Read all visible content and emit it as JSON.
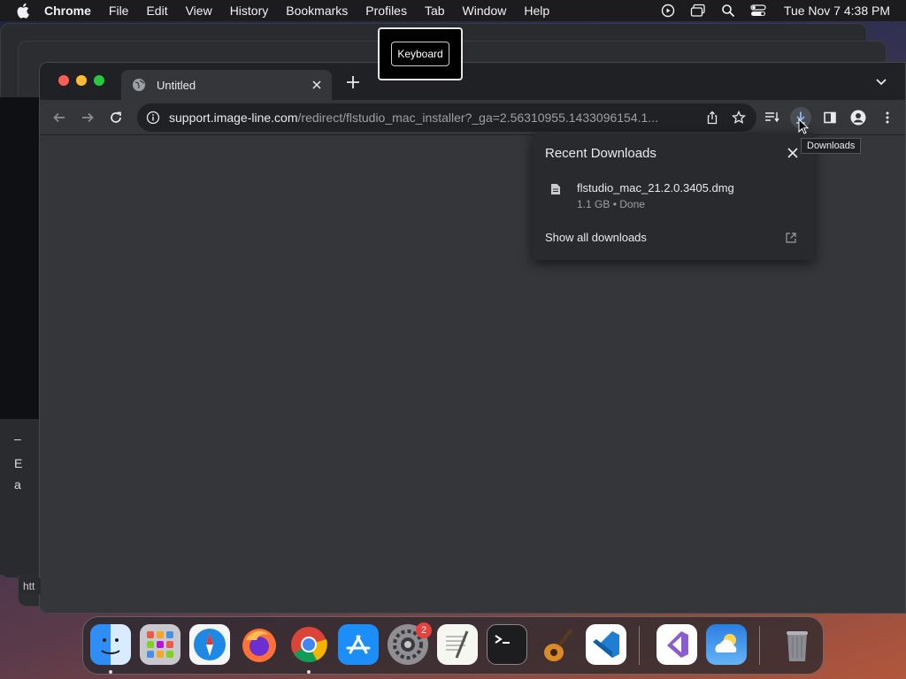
{
  "menubar": {
    "app": "Chrome",
    "items": [
      "File",
      "Edit",
      "View",
      "History",
      "Bookmarks",
      "Profiles",
      "Tab",
      "Window",
      "Help"
    ],
    "clock": "Tue Nov 7  4:38 PM"
  },
  "browser": {
    "tab_title": "Untitled",
    "url_domain": "support.image-line.com",
    "url_path": "/redirect/flstudio_mac_installer?_ga=2.56310955.1433096154.1...",
    "status_text": "htt"
  },
  "downloads": {
    "title": "Recent Downloads",
    "file_name": "flstudio_mac_21.2.0.3405.dmg",
    "file_meta": "1.1 GB • Done",
    "show_all": "Show all downloads",
    "tooltip": "Downloads"
  },
  "keyboard_badge": "Keyboard",
  "background_text": [
    "–",
    "E",
    "a"
  ],
  "dock": {
    "apps": [
      "finder",
      "launchpad",
      "safari",
      "firefox",
      "chrome",
      "app-store",
      "system-settings",
      "textedit",
      "terminal",
      "garageband",
      "vscode",
      "visual-studio",
      "weather",
      "trash"
    ],
    "settings_badge": "2"
  },
  "colors": {
    "accent": "#8ab4f8",
    "toolbar": "#35363a",
    "tabstrip": "#202124",
    "popup": "#292a2d"
  }
}
